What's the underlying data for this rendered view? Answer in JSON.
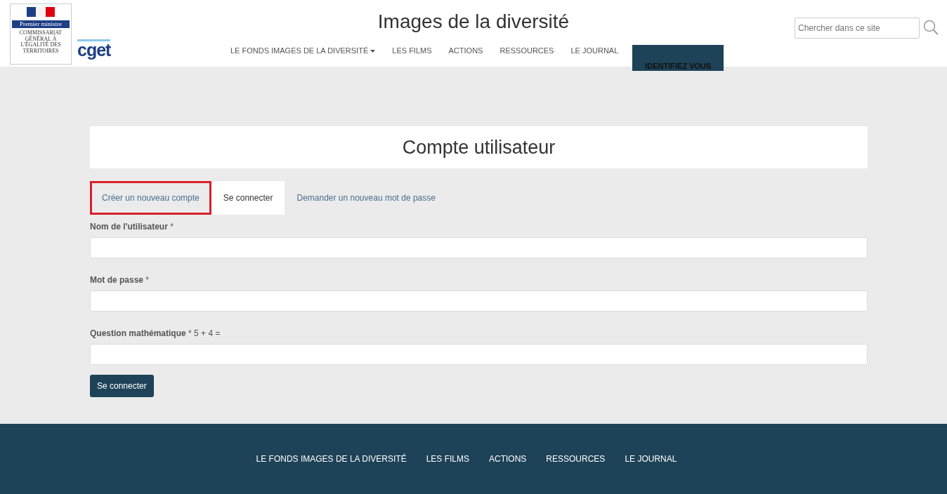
{
  "logo": {
    "band": "Premier ministre",
    "org": "COMMISSARIAT GÉNÉRAL À L'ÉGALITÉ DES TERRITOIRES",
    "wordmark": "cget"
  },
  "site_title": "Images de la diversité",
  "nav": [
    {
      "label": "LE FONDS IMAGES DE LA DIVERSITÉ",
      "kind": "dropdown"
    },
    {
      "label": "LES FILMS",
      "kind": "link"
    },
    {
      "label": "ACTIONS",
      "kind": "link"
    },
    {
      "label": "RESSOURCES",
      "kind": "link"
    },
    {
      "label": "LE JOURNAL",
      "kind": "link"
    },
    {
      "label": "IDENTIFIEZ VOUS",
      "kind": "button"
    }
  ],
  "search": {
    "placeholder": "Chercher dans ce site"
  },
  "page_title": "Compte utilisateur",
  "tabs": [
    {
      "label": "Créer un nouveau compte",
      "selected": false,
      "highlighted": true
    },
    {
      "label": "Se connecter",
      "selected": true,
      "highlighted": false
    },
    {
      "label": "Demander un nouveau mot de passe",
      "selected": false,
      "highlighted": false
    }
  ],
  "fields": [
    {
      "label": "**Nom de l'utilisateur** *"
    },
    {
      "label": "**Mot de passe** *"
    },
    {
      "label": "**Question mathématique** * 5 + 4 ="
    }
  ],
  "submit": "Se connecter",
  "footer_links": [
    "LE FONDS IMAGES DE LA DIVERSITÉ",
    "LES FILMS",
    "ACTIONS",
    "RESSOURCES",
    "LE JOURNAL"
  ]
}
